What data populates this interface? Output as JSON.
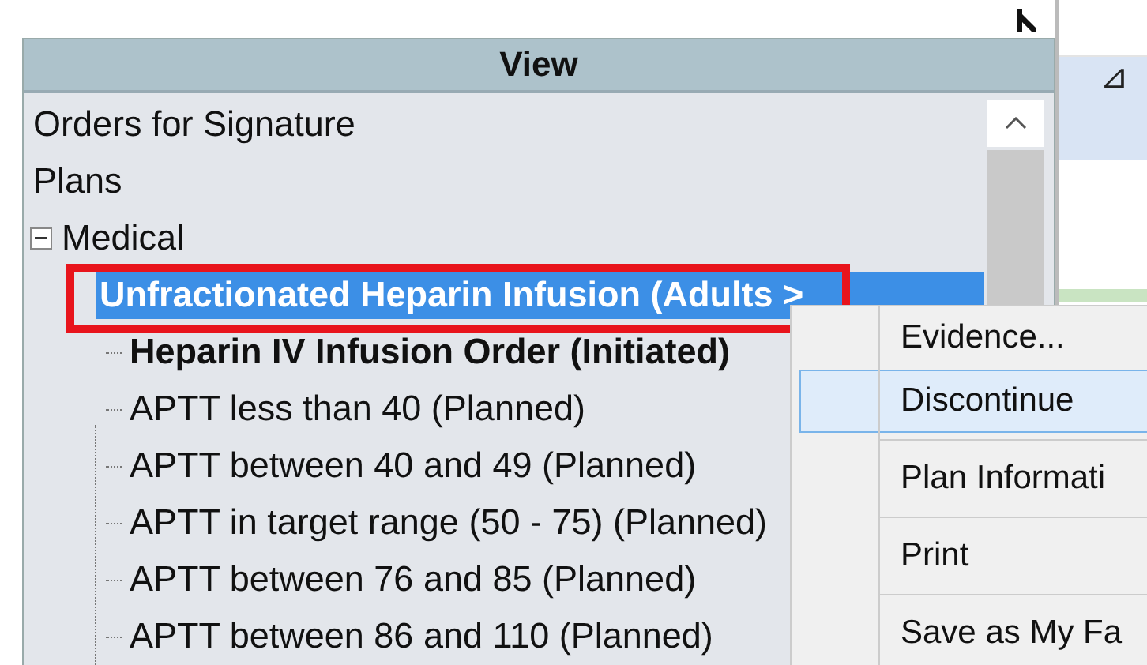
{
  "view_panel": {
    "title": "View",
    "tree": [
      {
        "label": "Orders for Signature",
        "selected": false
      },
      {
        "label": "Plans",
        "selected": false
      },
      {
        "label": "Medical",
        "selected": false,
        "expanded": true,
        "children": [
          {
            "label": "Unfractionated Heparin Infusion (Adults >",
            "selected": true,
            "children": [
              {
                "label": "Heparin IV Infusion Order (Initiated)",
                "selected": false,
                "bold": true
              },
              {
                "label": "APTT less than 40 (Planned)",
                "selected": false,
                "bold": false
              },
              {
                "label": "APTT between 40 and 49 (Planned)",
                "selected": false,
                "bold": false
              },
              {
                "label": "APTT in target range (50 - 75) (Planned)",
                "selected": false,
                "bold": false
              },
              {
                "label": "APTT between 76 and 85 (Planned)",
                "selected": false,
                "bold": false
              },
              {
                "label": "APTT between 86 and 110 (Planned)",
                "selected": false,
                "bold": false
              }
            ]
          }
        ]
      }
    ]
  },
  "side_panel": {
    "glyph": "⊿"
  },
  "context_menu": [
    {
      "kind": "item",
      "label": "Evidence...",
      "selected": false
    },
    {
      "kind": "item",
      "label": "Discontinue",
      "selected": true
    },
    {
      "kind": "separator"
    },
    {
      "kind": "item",
      "label": "Plan Informati",
      "selected": false
    },
    {
      "kind": "separator"
    },
    {
      "kind": "item",
      "label": "Print",
      "selected": false
    },
    {
      "kind": "separator"
    },
    {
      "kind": "item",
      "label": "Save as My Fa",
      "selected": false
    }
  ]
}
